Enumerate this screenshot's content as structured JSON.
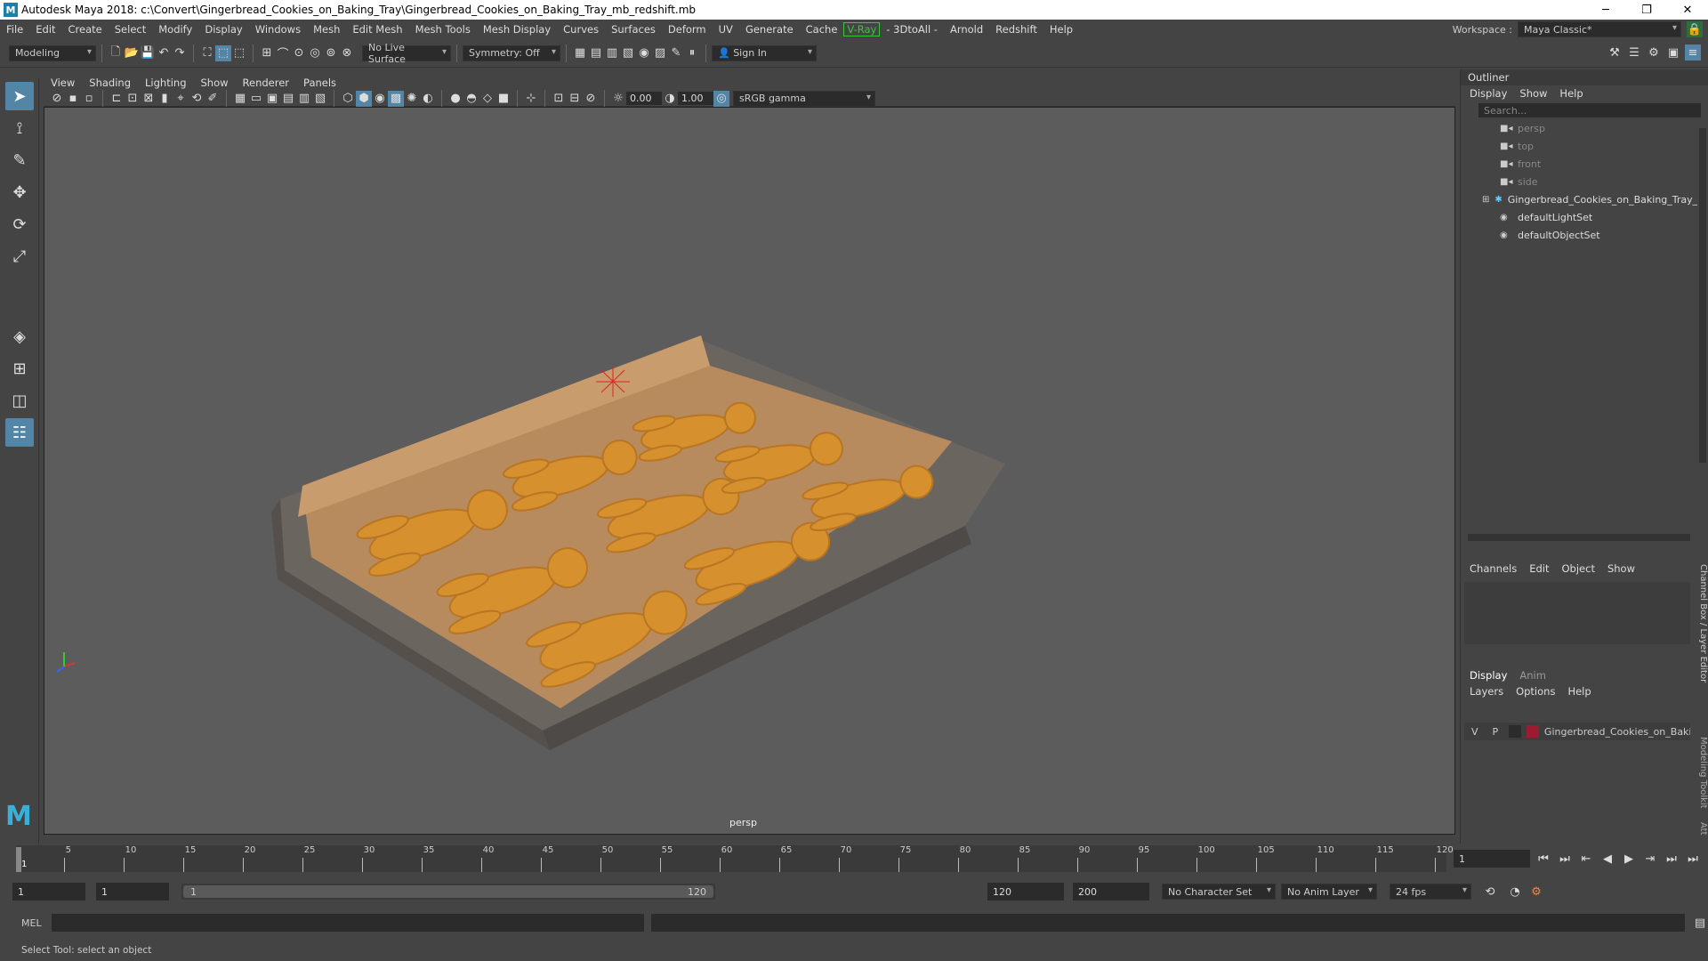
{
  "window": {
    "title": "Autodesk Maya 2018: c:\\Convert\\Gingerbread_Cookies_on_Baking_Tray\\Gingerbread_Cookies_on_Baking_Tray_mb_redshift.mb"
  },
  "menubar": {
    "items": [
      "File",
      "Edit",
      "Create",
      "Select",
      "Modify",
      "Display",
      "Windows",
      "Mesh",
      "Edit Mesh",
      "Mesh Tools",
      "Mesh Display",
      "Curves",
      "Surfaces",
      "Deform",
      "UV",
      "Generate",
      "Cache"
    ],
    "vray": "V-Ray",
    "items2": [
      "- 3DtoAll -",
      "Arnold",
      "Redshift",
      "Help"
    ],
    "workspace_label": "Workspace :",
    "workspace_value": "Maya Classic*"
  },
  "shelf": {
    "mode": "Modeling",
    "live_surface": "No Live Surface",
    "symmetry": "Symmetry: Off",
    "sign_in": "Sign In"
  },
  "viewport": {
    "menu": [
      "View",
      "Shading",
      "Lighting",
      "Show",
      "Renderer",
      "Panels"
    ],
    "exposure": "0.00",
    "gamma": "1.00",
    "colorspace": "sRGB gamma",
    "camera_label": "persp"
  },
  "outliner": {
    "title": "Outliner",
    "menu": [
      "Display",
      "Show",
      "Help"
    ],
    "search_placeholder": "Search...",
    "items": [
      {
        "label": "persp",
        "dim": true,
        "icon": "camera-icon"
      },
      {
        "label": "top",
        "dim": true,
        "icon": "camera-icon"
      },
      {
        "label": "front",
        "dim": true,
        "icon": "camera-icon"
      },
      {
        "label": "side",
        "dim": true,
        "icon": "camera-icon"
      },
      {
        "label": "Gingerbread_Cookies_on_Baking_Tray_r",
        "dim": false,
        "icon": "group-icon"
      },
      {
        "label": "defaultLightSet",
        "dim": false,
        "icon": "set-icon"
      },
      {
        "label": "defaultObjectSet",
        "dim": false,
        "icon": "set-icon"
      }
    ]
  },
  "channelbox": {
    "menu": [
      "Channels",
      "Edit",
      "Object",
      "Show"
    ],
    "side_tab1": "Channel Box / Layer Editor",
    "side_tab2": "Modeling Toolkit",
    "side_tab3": "Att"
  },
  "layers": {
    "tabs": [
      "Display",
      "Anim"
    ],
    "menu": [
      "Layers",
      "Options",
      "Help"
    ],
    "row": {
      "v": "V",
      "p": "P",
      "name": "Gingerbread_Cookies_on_Baki",
      "color": "#9b1b30"
    }
  },
  "timeline": {
    "ticks": [
      "5",
      "10",
      "15",
      "20",
      "25",
      "30",
      "35",
      "40",
      "45",
      "50",
      "55",
      "60",
      "65",
      "70",
      "75",
      "80",
      "85",
      "90",
      "95",
      "100",
      "105",
      "110",
      "115",
      "120"
    ],
    "current": "1",
    "current_field": "1"
  },
  "range": {
    "start": "1",
    "inner_start": "1",
    "slider_start": "1",
    "slider_end": "120",
    "end": "120",
    "anim_end": "200",
    "character_set": "No Character Set",
    "anim_layer": "No Anim Layer",
    "fps": "24 fps"
  },
  "cmdline": {
    "label": "MEL"
  },
  "help": {
    "text": "Select Tool: select an object"
  }
}
